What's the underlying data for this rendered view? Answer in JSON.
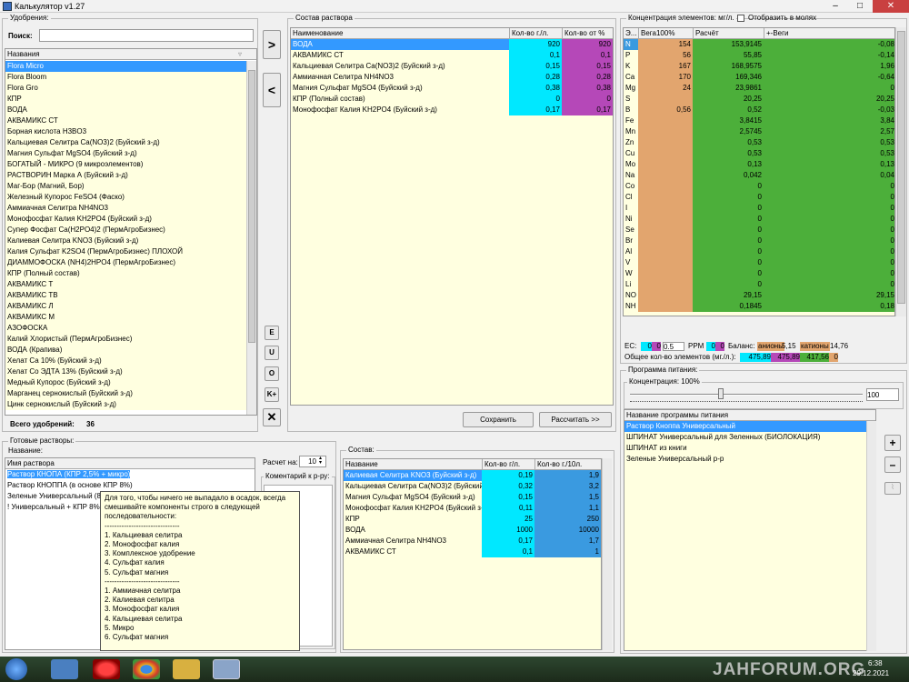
{
  "title": "Калькулятор v1.27",
  "window_buttons": {
    "min": "–",
    "max": "□",
    "close": "✕"
  },
  "fert": {
    "group": "Удобрения:",
    "search_label": "Поиск:",
    "search_value": "",
    "col": "Названия",
    "items": [
      "Flora Micro",
      "Flora Bloom",
      "Flora Gro",
      "КПР",
      "ВОДА",
      "АКВАМИКС СТ",
      "Борная кислота H3BO3",
      "Кальциевая Селитра Ca(NO3)2 (Буйский з-д)",
      "Магния Сульфат MgSO4 (Буйский з-д)",
      "БОГАТЫЙ - МИКРО (9 микроэлементов)",
      "РАСТВОРИН Марка А (Буйский з-д)",
      "Маг-Бор (Магний, Бор)",
      "Железный Купорос FeSO4 (Фаско)",
      "Аммиачная Селитра NH4NO3",
      "Монофосфат Калия KH2PO4 (Буйский з-д)",
      "Супер Фосфат Ca(H2PO4)2 (ПермАгроБизнес)",
      "Калиевая Селитра KNO3 (Буйский з-д)",
      "Калия Сульфат K2SO4 (ПермАгроБизнес) ПЛОХОЙ",
      "ДИАММОФОСКА (NH4)2HPO4 (ПермАгроБизнес)",
      "КПР (Полный состав)",
      "АКВАМИКС Т",
      "АКВАМИКС ТВ",
      "АКВАМИКС Л",
      "АКВАМИКС М",
      "АЗОФОСКА",
      "Калий Хлористый (ПермАгроБизнес)",
      "ВОДА (Крапива)",
      "Хелат Са 10% (Буйский з-д)",
      "Хелат Со ЭДТА 13% (Буйский з-д)",
      "Медный Купорос (Буйский з-д)",
      "Марганец сернокислый (Буйский з-д)",
      "Цинк сернокислый (Буйский з-д)"
    ],
    "total_label": "Всего удобрений:",
    "total": "36"
  },
  "mid_buttons": {
    "add": ">",
    "remove": "<",
    "e": "E",
    "u": "U",
    "o": "O",
    "k": "K+",
    "x": "✕"
  },
  "comp": {
    "group": "Состав раствора",
    "cols": [
      "Наименование",
      "Кол-во г./л.",
      "Кол-во от %"
    ],
    "rows": [
      [
        "ВОДА",
        "920",
        "920"
      ],
      [
        "АКВАМИКС СТ",
        "0,1",
        "0,1"
      ],
      [
        "Кальциевая Селитра Ca(NO3)2 (Буйский з-д)",
        "0,15",
        "0,15"
      ],
      [
        "Аммиачная Селитра NH4NO3",
        "0,28",
        "0,28"
      ],
      [
        "Магния Сульфат MgSO4 (Буйский з-д)",
        "0,38",
        "0,38"
      ],
      [
        "КПР (Полный состав)",
        "0",
        "0"
      ],
      [
        "Монофосфат Калия KH2PO4 (Буйский з-д)",
        "0,17",
        "0,17"
      ]
    ],
    "save": "Сохранить",
    "calc": "Рассчитать >>"
  },
  "conc": {
    "group": "Концентрация элементов: мг/л.",
    "moles": "Отобразить в молях",
    "cols": [
      "Э...",
      "Вега100%",
      "Расчёт",
      "+-Веги"
    ],
    "rows": [
      [
        "N",
        "154",
        "153,9145",
        "-0,08"
      ],
      [
        "P",
        "56",
        "55,85",
        "-0,14"
      ],
      [
        "K",
        "167",
        "168,9575",
        "1,96"
      ],
      [
        "Ca",
        "170",
        "169,346",
        "-0,64"
      ],
      [
        "Mg",
        "24",
        "23,9861",
        "0"
      ],
      [
        "S",
        "",
        "20,25",
        "20,25"
      ],
      [
        "B",
        "0,56",
        "0,52",
        "-0,03"
      ],
      [
        "Fe",
        "",
        "3,8415",
        "3,84"
      ],
      [
        "Mn",
        "",
        "2,5745",
        "2,57"
      ],
      [
        "Zn",
        "",
        "0,53",
        "0,53"
      ],
      [
        "Cu",
        "",
        "0,53",
        "0,53"
      ],
      [
        "Mo",
        "",
        "0,13",
        "0,13"
      ],
      [
        "Na",
        "",
        "0,042",
        "0,04"
      ],
      [
        "Co",
        "",
        "0",
        "0"
      ],
      [
        "Cl",
        "",
        "0",
        "0"
      ],
      [
        "I",
        "",
        "0",
        "0"
      ],
      [
        "Ni",
        "",
        "0",
        "0"
      ],
      [
        "Se",
        "",
        "0",
        "0"
      ],
      [
        "Br",
        "",
        "0",
        "0"
      ],
      [
        "Al",
        "",
        "0",
        "0"
      ],
      [
        "V",
        "",
        "0",
        "0"
      ],
      [
        "W",
        "",
        "0",
        "0"
      ],
      [
        "Li",
        "",
        "0",
        "0"
      ],
      [
        "NO",
        "",
        "29,15",
        "29,15"
      ],
      [
        "NH",
        "",
        "0,1845",
        "0,18"
      ]
    ],
    "ec_label": "EC:",
    "ec1": "0",
    "ec2": "0",
    "ec3": "0.5",
    "ppm_label": "PPM",
    "ppm1": "0",
    "ppm2": "0",
    "balance_label": "Баланс:",
    "anions_label": "анионы",
    "anions": "5,15",
    "cations_label": "катионы",
    "cations": "14,76",
    "total_label": "Общее кол-во элементов (мг./л.):",
    "t1": "475,89",
    "t2": "475,89",
    "t3": "417,56",
    "t4": "0"
  },
  "prog": {
    "group": "Программа питания:",
    "conc_label": "Концентрация: 100%",
    "conc_value": "100",
    "col": "Название программы питания",
    "items": [
      "Раствор Кноппа Универсальный",
      "ШПИНАТ Универсальный для Зеленных (БИОЛОКАЦИЯ)",
      "ШПИНАТ из книги",
      "Зеленые Универсальный р-р"
    ],
    "plus": "+",
    "minus": "–"
  },
  "ready": {
    "group": "Готовые растворы:",
    "sub": "Название:",
    "col": "Имя раствора",
    "items": [
      "Раствор КНОПА (КПР 2,5% + микро)",
      "Раствор КНОППА (в основе КПР 8%)",
      "Зеленые Универсальный (8",
      "! Универсальный + КПР 8%"
    ],
    "calc_on": "Расчет на:",
    "calc_value": "10",
    "comment": "Коментарий к р-ру:"
  },
  "tooltip": [
    "Для того, чтобы ничего не выпадало в осадок, всегда",
    "смешивайте компоненты строго в следующей",
    "последовательности:",
    "-------------------------------",
    "1. Кальциевая селитра",
    "2. Монофосфат калия",
    "3. Комплексное удобрение",
    "4. Сульфат калия",
    "5. Сульфат магния",
    "-------------------------------",
    "1. Аммиачная селитра",
    "2. Калиевая селитра",
    "3. Монофосфат калия",
    "4. Кальциевая селитра",
    "5. Микро",
    "6. Сульфат магния"
  ],
  "ready_comp": {
    "group": "Состав:",
    "cols": [
      "Название",
      "Кол-во г/л.",
      "Кол-во г./10л."
    ],
    "rows": [
      [
        "Калиевая Селитра KNO3 (Буйский з-д)",
        "0,19",
        "1,9"
      ],
      [
        "Кальциевая Селитра Ca(NO3)2 (Буйский з-д)",
        "0,32",
        "3,2"
      ],
      [
        "Магния Сульфат MgSO4 (Буйский з-д)",
        "0,15",
        "1,5"
      ],
      [
        "Монофосфат Калия KH2PO4 (Буйский з-д)",
        "0,11",
        "1,1"
      ],
      [
        "КПР",
        "25",
        "250"
      ],
      [
        "ВОДА",
        "1000",
        "10000"
      ],
      [
        "Аммиачная Селитра NH4NO3",
        "0,17",
        "1,7"
      ],
      [
        "АКВАМИКС СТ",
        "0,1",
        "1"
      ]
    ]
  },
  "taskbar": {
    "watermark": "JAHFORUM.ORG",
    "time": "6:38",
    "date": "29.12.2021"
  }
}
